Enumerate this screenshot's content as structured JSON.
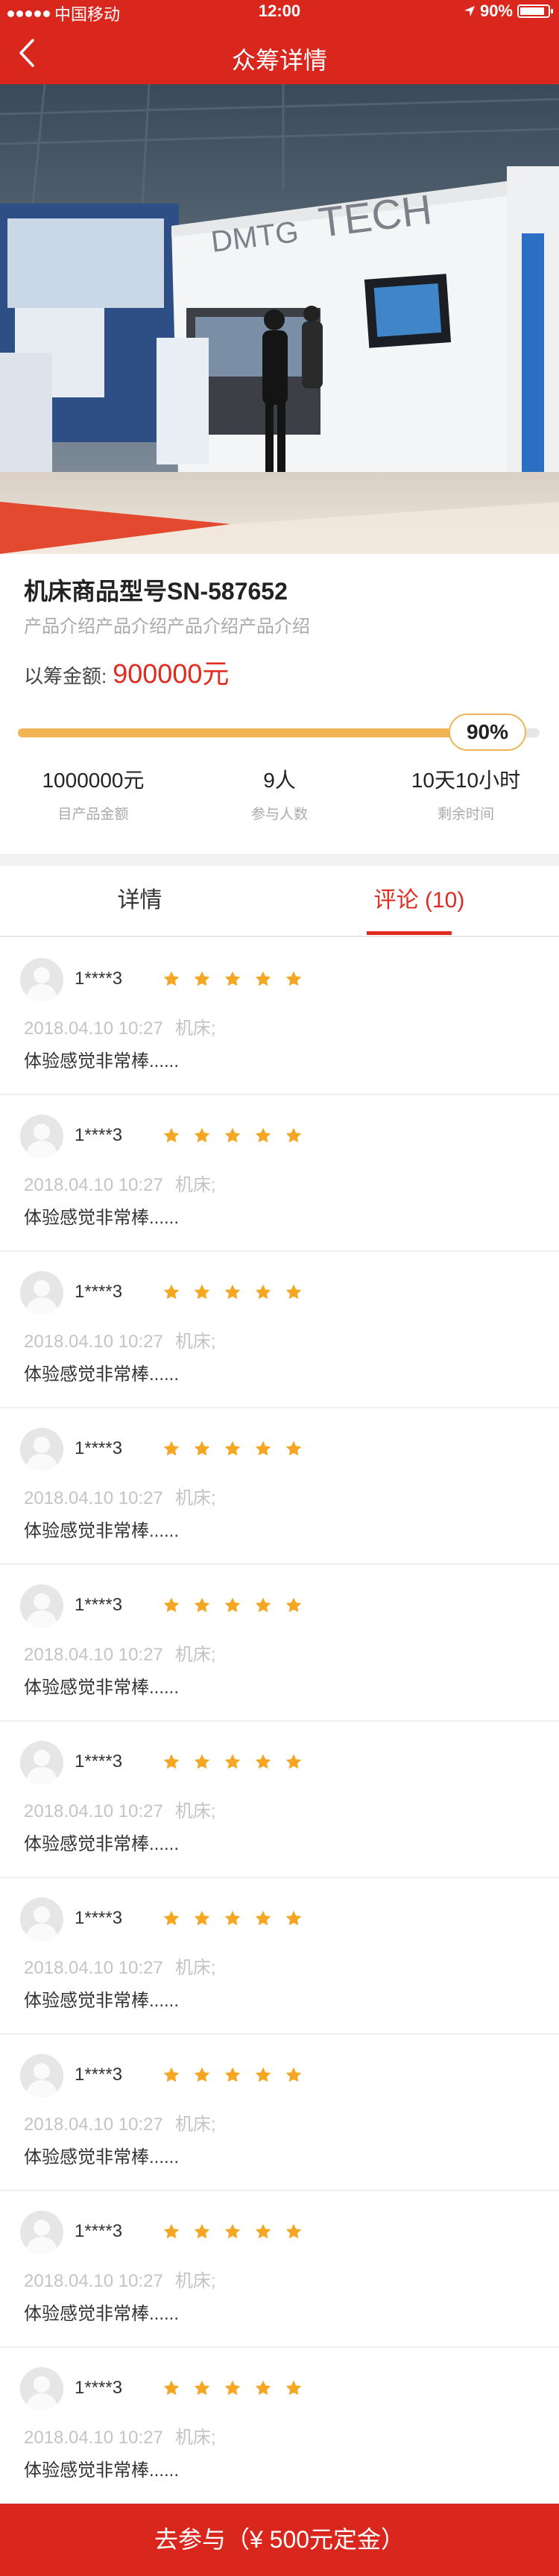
{
  "status_bar": {
    "carrier": "中国移动",
    "time": "12:00",
    "battery": "90%",
    "battery_level": 0.9
  },
  "nav": {
    "title": "众筹详情"
  },
  "hero": {
    "booth_sign_1": "DMTG",
    "booth_sign_2": "TECH"
  },
  "product": {
    "name": "机床商品型号SN-587652",
    "description": "产品介绍产品介绍产品介绍产品介绍",
    "raised_label": "以筹金额:",
    "raised_amount": "900000元",
    "progress_label": "90%",
    "progress_value": 0.9
  },
  "stats": [
    {
      "value": "1000000元",
      "label": "目产品金额"
    },
    {
      "value": "9人",
      "label": "参与人数"
    },
    {
      "value": "10天10小时",
      "label": "剩余时间"
    }
  ],
  "tabs": {
    "details": "详情",
    "comments": "评论 (10)"
  },
  "comments": [
    {
      "user": "1****3",
      "rating": 5,
      "date": "2018.04.10 10:27",
      "category": "机床;",
      "text": "体验感觉非常棒......"
    },
    {
      "user": "1****3",
      "rating": 5,
      "date": "2018.04.10 10:27",
      "category": "机床;",
      "text": "体验感觉非常棒......"
    },
    {
      "user": "1****3",
      "rating": 5,
      "date": "2018.04.10 10:27",
      "category": "机床;",
      "text": "体验感觉非常棒......"
    },
    {
      "user": "1****3",
      "rating": 5,
      "date": "2018.04.10 10:27",
      "category": "机床;",
      "text": "体验感觉非常棒......"
    },
    {
      "user": "1****3",
      "rating": 5,
      "date": "2018.04.10 10:27",
      "category": "机床;",
      "text": "体验感觉非常棒......"
    },
    {
      "user": "1****3",
      "rating": 5,
      "date": "2018.04.10 10:27",
      "category": "机床;",
      "text": "体验感觉非常棒......"
    },
    {
      "user": "1****3",
      "rating": 5,
      "date": "2018.04.10 10:27",
      "category": "机床;",
      "text": "体验感觉非常棒......"
    },
    {
      "user": "1****3",
      "rating": 5,
      "date": "2018.04.10 10:27",
      "category": "机床;",
      "text": "体验感觉非常棒......"
    },
    {
      "user": "1****3",
      "rating": 5,
      "date": "2018.04.10 10:27",
      "category": "机床;",
      "text": "体验感觉非常棒......"
    },
    {
      "user": "1****3",
      "rating": 5,
      "date": "2018.04.10 10:27",
      "category": "机床;",
      "text": "体验感觉非常棒......"
    }
  ],
  "cta": {
    "label": "去参与（¥ 500元定金）"
  },
  "colors": {
    "brand_red": "#d9271e",
    "accent_red": "#e02c20",
    "progress": "#f0b452",
    "star": "#f5a623"
  }
}
